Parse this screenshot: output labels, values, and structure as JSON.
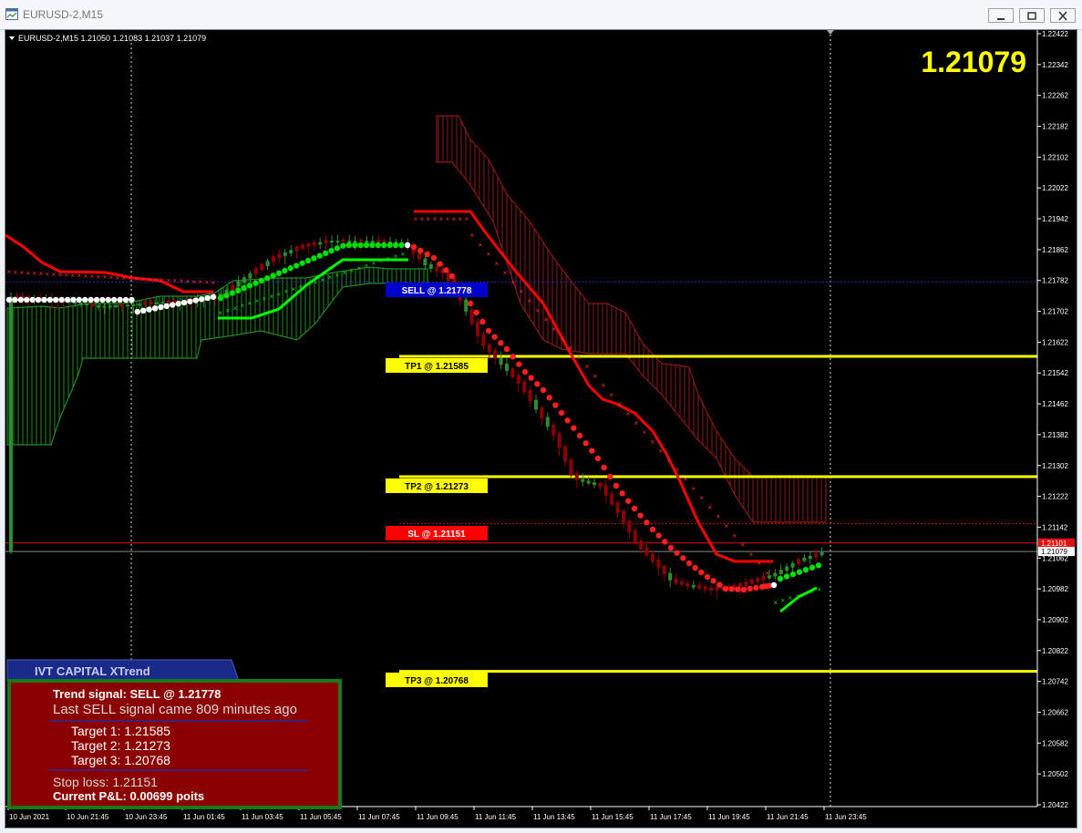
{
  "window": {
    "title": "EURUSD-2,M15",
    "buttons": [
      "minimize",
      "restore",
      "close"
    ]
  },
  "chart_header": {
    "symbol_info": "EURUSD-2,M15  1.21050 1.21083 1.21037 1.21079"
  },
  "big_price": "1.21079",
  "price_axis": {
    "labels": [
      "1.22422",
      "1.22342",
      "1.22262",
      "1.22182",
      "1.22102",
      "1.22022",
      "1.21942",
      "1.21862",
      "1.21782",
      "1.21702",
      "1.21622",
      "1.21542",
      "1.21462",
      "1.21382",
      "1.21302",
      "1.21222",
      "1.21142",
      "1.21062",
      "1.20982",
      "1.20902",
      "1.20822",
      "1.20742",
      "1.20662",
      "1.20582",
      "1.20502",
      "1.20422"
    ],
    "current_price_tag": "1.21079",
    "ask_price_tag": "1.21101",
    "bid_hidden_tag": "1.21062"
  },
  "time_axis": {
    "labels": [
      "10 Jun 2021",
      "10 Jun 21:45",
      "10 Jun 23:45",
      "11 Jun 01:45",
      "11 Jun 03:45",
      "11 Jun 05:45",
      "11 Jun 07:45",
      "11 Jun 09:45",
      "11 Jun 11:45",
      "11 Jun 13:45",
      "11 Jun 15:45",
      "11 Jun 17:45",
      "11 Jun 19:45",
      "11 Jun 21:45",
      "11 Jun 23:45"
    ]
  },
  "levels": {
    "sell": {
      "label": "SELL @ 1.21778",
      "price": 1.21778,
      "color": "#0000cc"
    },
    "tp1": {
      "label": "TP1 @ 1.21585",
      "price": 1.21585,
      "color": "#ffff00"
    },
    "tp2": {
      "label": "TP2 @ 1.21273",
      "price": 1.21273,
      "color": "#ffff00"
    },
    "sl": {
      "label": "SL @ 1.21151",
      "price": 1.21151,
      "color": "#ff0000"
    },
    "tp3": {
      "label": "TP3 @ 1.20768",
      "price": 1.20768,
      "color": "#ffff00"
    }
  },
  "panel": {
    "tab_title": "IVT CAPITAL XTrend",
    "trend_signal": "Trend signal: SELL @ 1.21778",
    "last_signal": "Last SELL signal came 809 minutes ago",
    "target1": "Target 1: 1.21585",
    "target2": "Target 2: 1.21273",
    "target3": "Target 3: 1.20768",
    "stop_loss": "Stop loss: 1.21151",
    "pnl": "Current P&L: 0.00699 poits"
  },
  "colors": {
    "background": "#000000",
    "bull_candle": "#2e8b2e",
    "bear_candle": "#8b0000",
    "cloud_green": "#228b22",
    "cloud_red": "#8b1a1a",
    "baseline_red": "#ff0000",
    "baseline_green": "#00ff00",
    "panel_bg": "#8b0000",
    "panel_border": "#1a7a1a",
    "tab_bg": "#1a2a8a"
  }
}
